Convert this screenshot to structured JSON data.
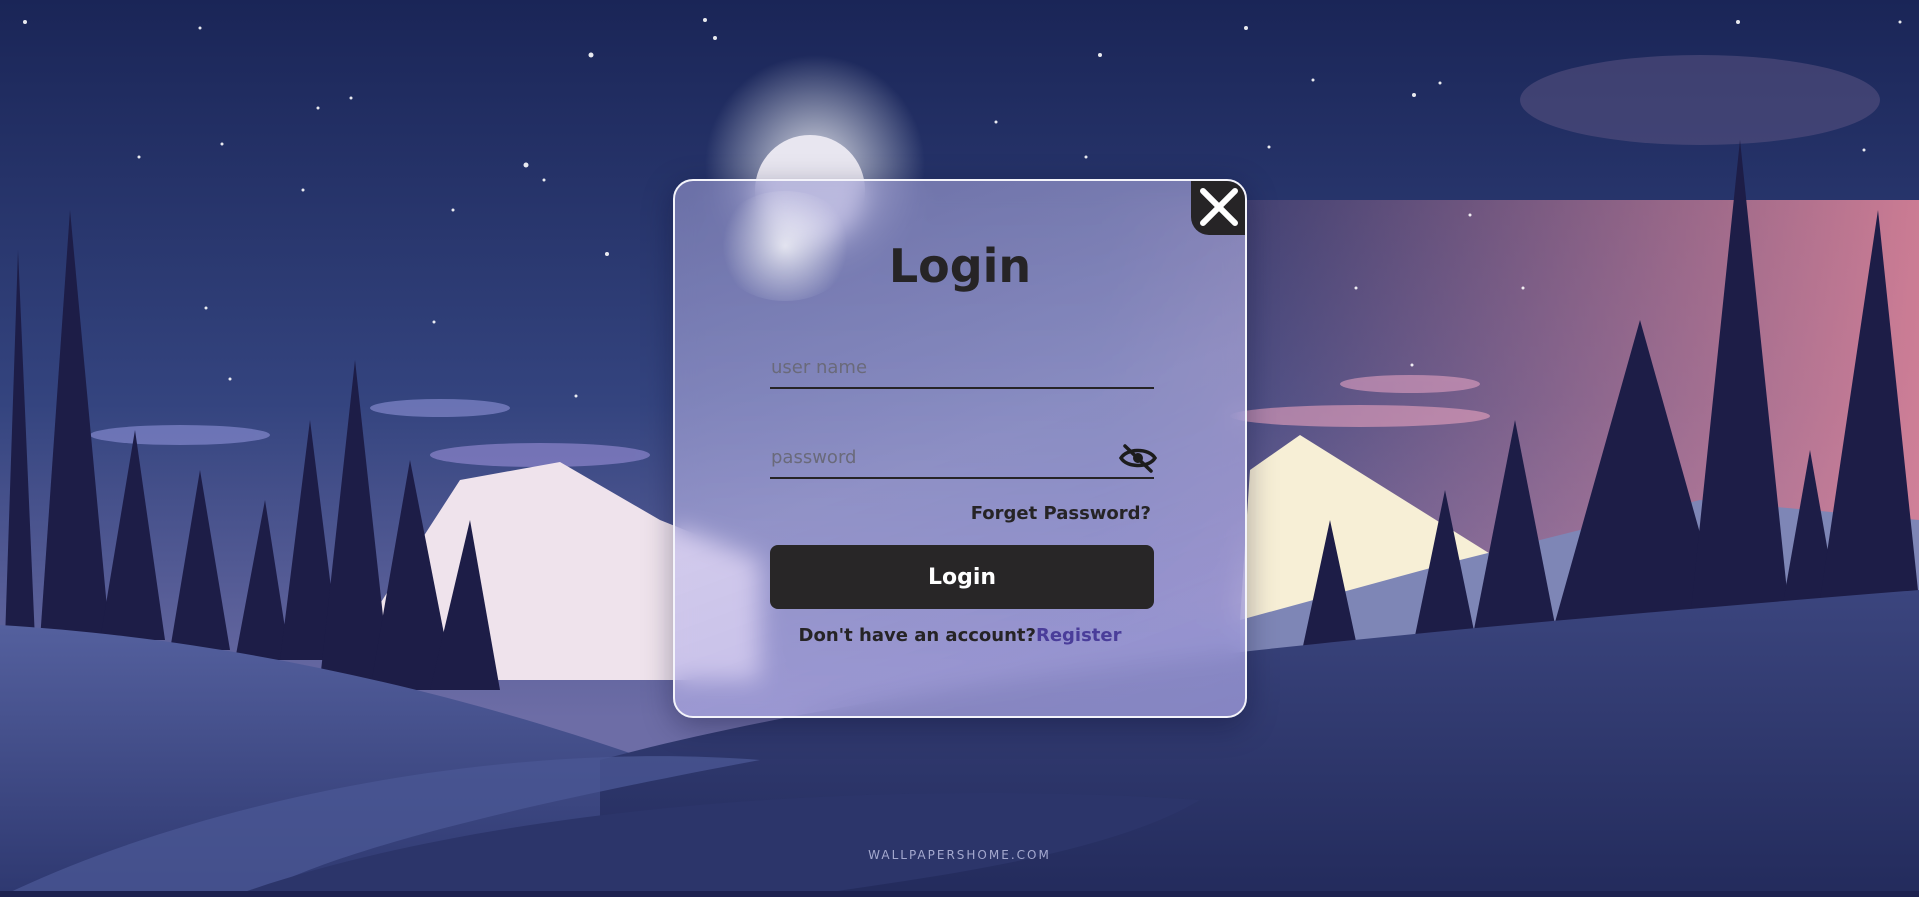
{
  "login_modal": {
    "title": "Login",
    "username": {
      "placeholder": "user name",
      "value": ""
    },
    "password": {
      "placeholder": "password",
      "value": ""
    },
    "forget_password": "Forget Password?",
    "submit_label": "Login",
    "no_account_text": "Don't have an account?",
    "register_link": "Register"
  },
  "background": {
    "watermark": "WALLPAPERSHOME.COM"
  },
  "icons": {
    "close": "close-icon",
    "password_visibility": "eye-slash-icon"
  },
  "colors": {
    "button_dark": "#282627",
    "text_dark": "#262426",
    "register_accent": "#4a3d9a",
    "sky_top": "#1b2558"
  }
}
